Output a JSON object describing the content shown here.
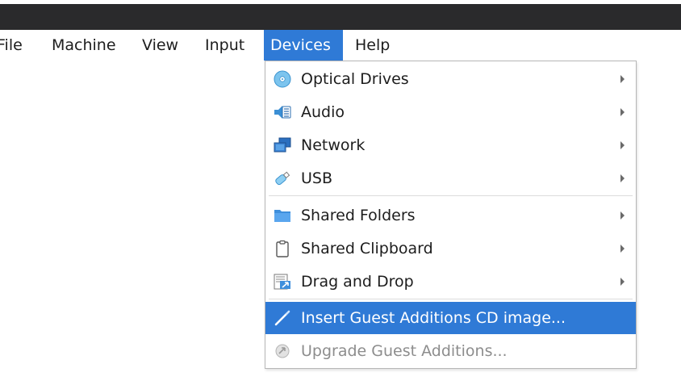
{
  "menubar": {
    "items": [
      {
        "label": "File"
      },
      {
        "label": "Machine"
      },
      {
        "label": "View"
      },
      {
        "label": "Input"
      },
      {
        "label": "Devices",
        "active": true
      },
      {
        "label": "Help"
      }
    ]
  },
  "devices_menu": {
    "items": [
      {
        "label": "Optical Drives",
        "icon": "optical-disc-icon",
        "has_submenu": true
      },
      {
        "label": "Audio",
        "icon": "audio-icon",
        "has_submenu": true
      },
      {
        "label": "Network",
        "icon": "network-icon",
        "has_submenu": true
      },
      {
        "label": "USB",
        "icon": "usb-icon",
        "has_submenu": true
      },
      {
        "label": "Shared Folders",
        "icon": "folder-icon",
        "has_submenu": true
      },
      {
        "label": "Shared Clipboard",
        "icon": "clipboard-icon",
        "has_submenu": true
      },
      {
        "label": "Drag and Drop",
        "icon": "drag-drop-icon",
        "has_submenu": true
      },
      {
        "label": "Insert Guest Additions CD image...",
        "icon": "wand-icon",
        "highlighted": true
      },
      {
        "label": "Upgrade Guest Additions...",
        "icon": "upgrade-icon",
        "disabled": true
      }
    ]
  },
  "colors": {
    "titlebar": "#2a2a2c",
    "highlight": "#2f7ad6",
    "disabled_text": "#8d8d8d"
  }
}
